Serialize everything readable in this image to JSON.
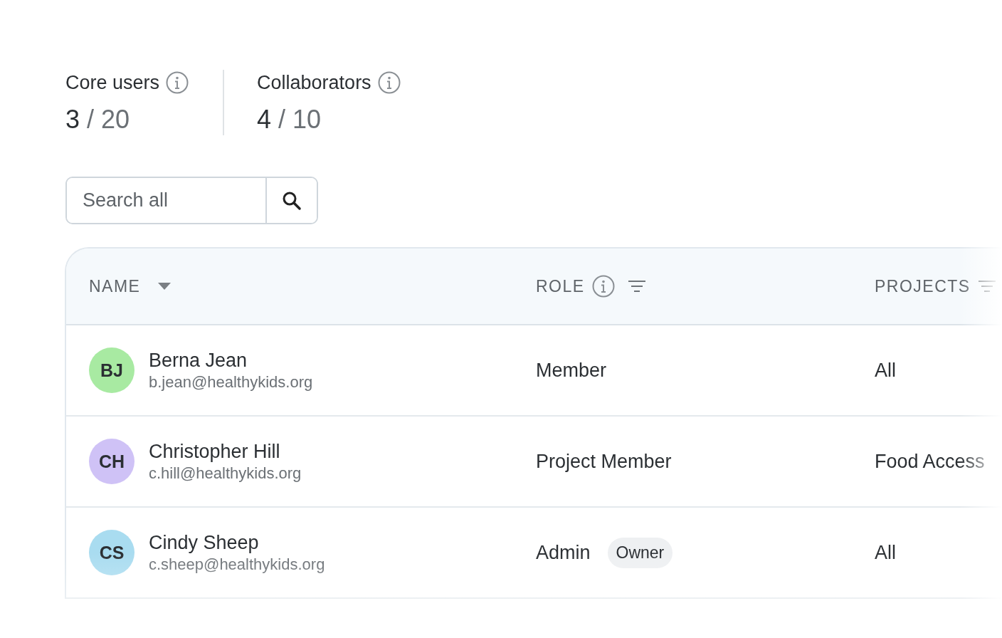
{
  "stats": [
    {
      "label": "Core users",
      "value": "3",
      "total": "/ 20"
    },
    {
      "label": "Collaborators",
      "value": "4",
      "total": "/ 10"
    }
  ],
  "search": {
    "placeholder": "Search all"
  },
  "table": {
    "columns": [
      {
        "label": "NAME",
        "kind": "sort"
      },
      {
        "label": "ROLE",
        "kind": "info_filter"
      },
      {
        "label": "PROJECTS",
        "kind": "filter"
      }
    ],
    "rows": [
      {
        "initials": "BJ",
        "color": "#a8eaa2",
        "name": "Berna Jean",
        "email": "b.jean@healthykids.org",
        "role": "Member",
        "projects": "All"
      },
      {
        "initials": "CH",
        "color": "#cfc2f6",
        "name": "Christopher Hill",
        "email": "c.hill@healthykids.org",
        "role": "Project Member",
        "projects": "Food Access"
      },
      {
        "initials": "CS",
        "color": "#a9dcf0",
        "name": "Cindy Sheep",
        "email": "c.sheep@healthykids.org",
        "role": "Admin",
        "badge": "Owner",
        "projects": "All"
      }
    ]
  }
}
